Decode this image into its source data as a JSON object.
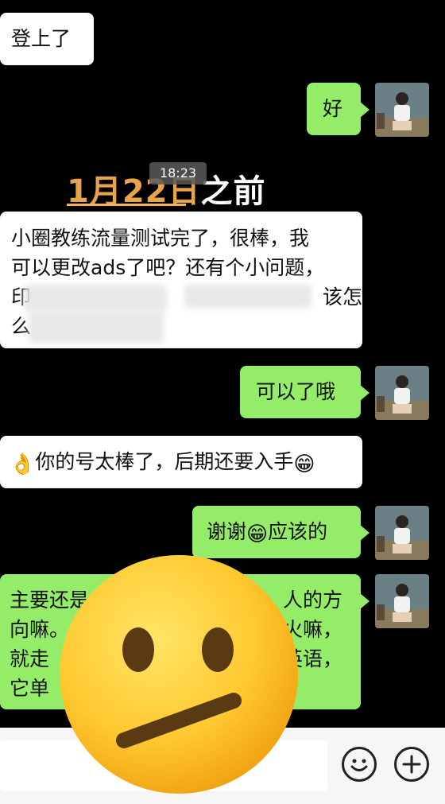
{
  "messages": [
    {
      "id": "m1",
      "side": "left",
      "text": "登上了"
    },
    {
      "id": "m2",
      "side": "right",
      "text": "好"
    },
    {
      "id": "m3",
      "side": "left",
      "line1": "小圈教练流量测试完了，很棒，我",
      "line2": "可以更改ads了吧？还有个小问题，",
      "line3_a": "印",
      "line3_b": "该怎",
      "line4_a": "么"
    },
    {
      "id": "m4",
      "side": "right",
      "text": "可以了哦"
    },
    {
      "id": "m5",
      "side": "left",
      "text": "你的号太棒了，后期还要入手",
      "emoji_start": "👌",
      "emoji_end": "😁"
    },
    {
      "id": "m6",
      "side": "right",
      "text_a": "谢谢",
      "emoji": "😁",
      "text_b": "应该的"
    },
    {
      "id": "m7",
      "side": "right",
      "line1_a": "主要还是",
      "line1_b": "人的方",
      "line2_a": "向嘛。",
      "line2_b": "火嘛，",
      "line3_a": "就走",
      "line3_b": "英语，",
      "line4_a": "它单"
    }
  ],
  "timestamp": "18:23",
  "sticker_title": {
    "date": "1月22日",
    "suffix": "之前"
  },
  "overlay_emoji": "😐",
  "input": {
    "emoji_button": "😊",
    "plus_button": "+"
  }
}
